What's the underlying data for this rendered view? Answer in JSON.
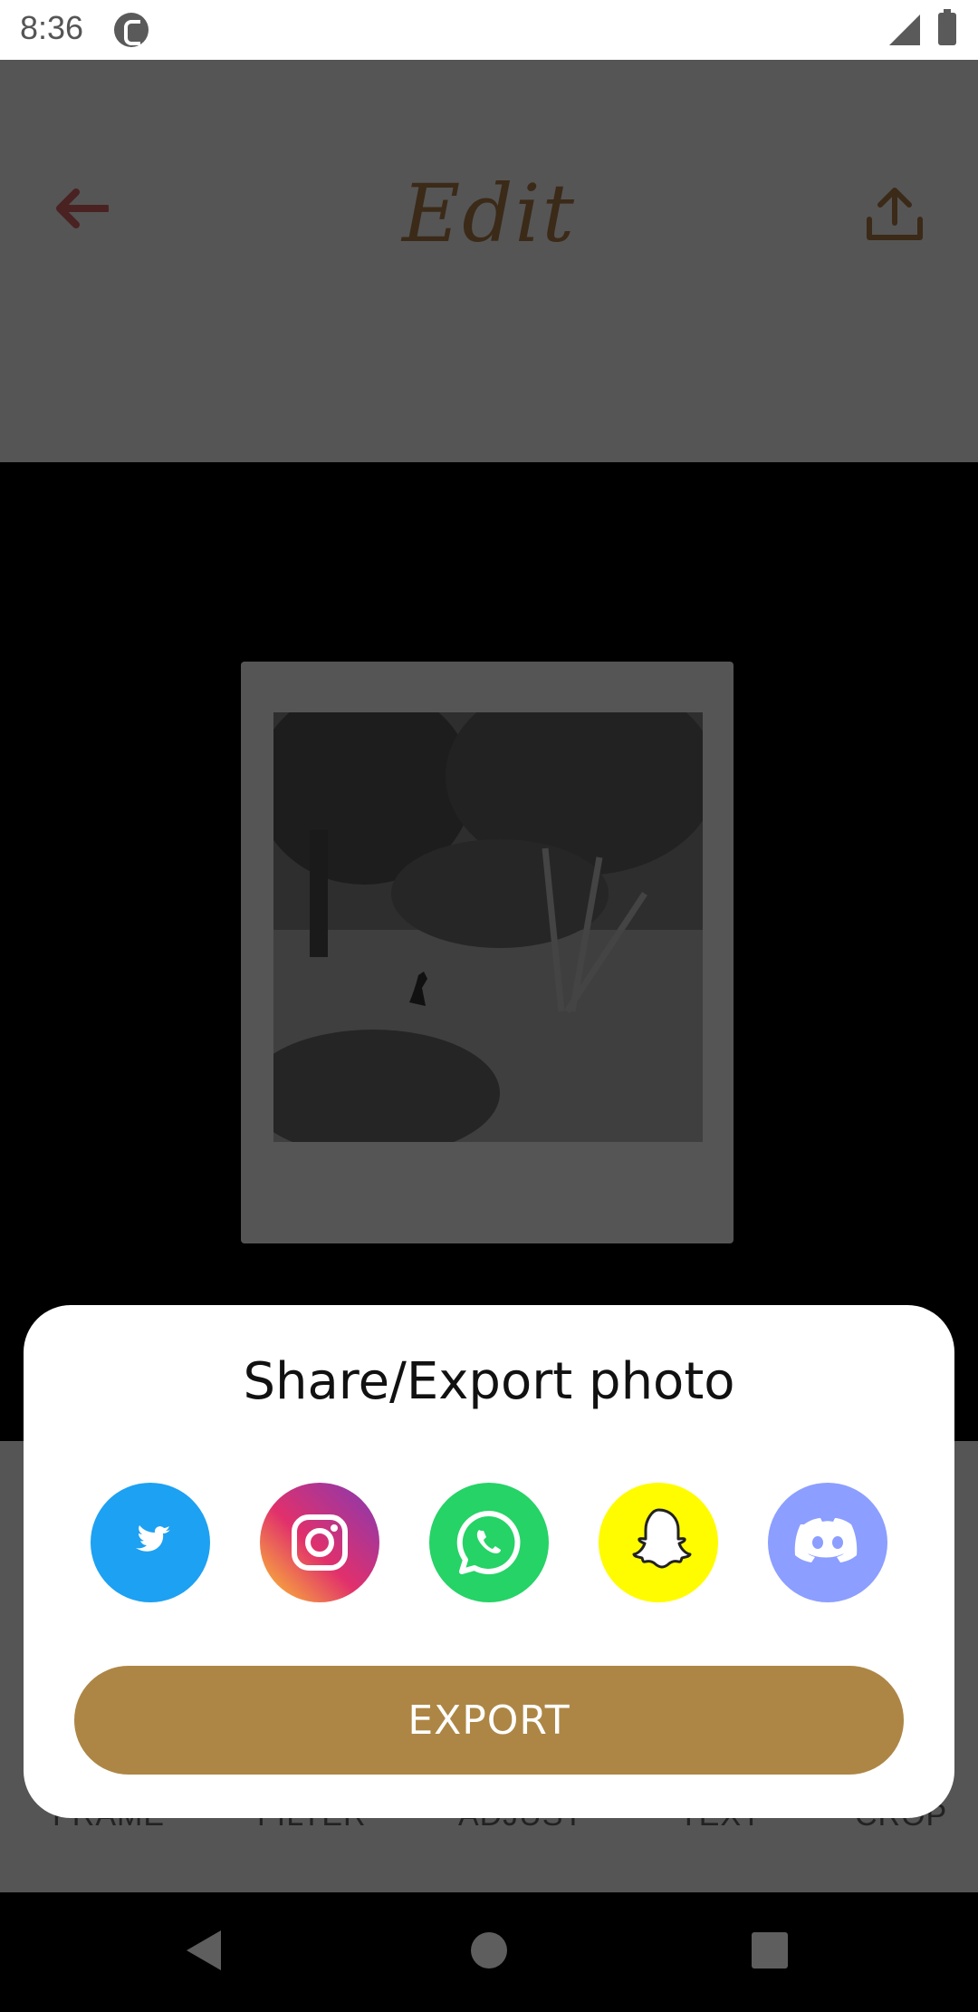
{
  "status_bar": {
    "time": "8:36"
  },
  "header": {
    "title": "Edit"
  },
  "toolbar": {
    "items": [
      "FRAME",
      "FILTER",
      "ADJUST",
      "TEXT",
      "CROP"
    ]
  },
  "dialog": {
    "title": "Share/Export photo",
    "share_targets": [
      {
        "name": "twitter",
        "color": "#1da1f2"
      },
      {
        "name": "instagram",
        "color": "#c13584"
      },
      {
        "name": "whatsapp",
        "color": "#25d366"
      },
      {
        "name": "snapchat",
        "color": "#fffc00"
      },
      {
        "name": "discord",
        "color": "#7289da"
      }
    ],
    "export_label": "EXPORT",
    "accent_color": "#ad8645"
  }
}
